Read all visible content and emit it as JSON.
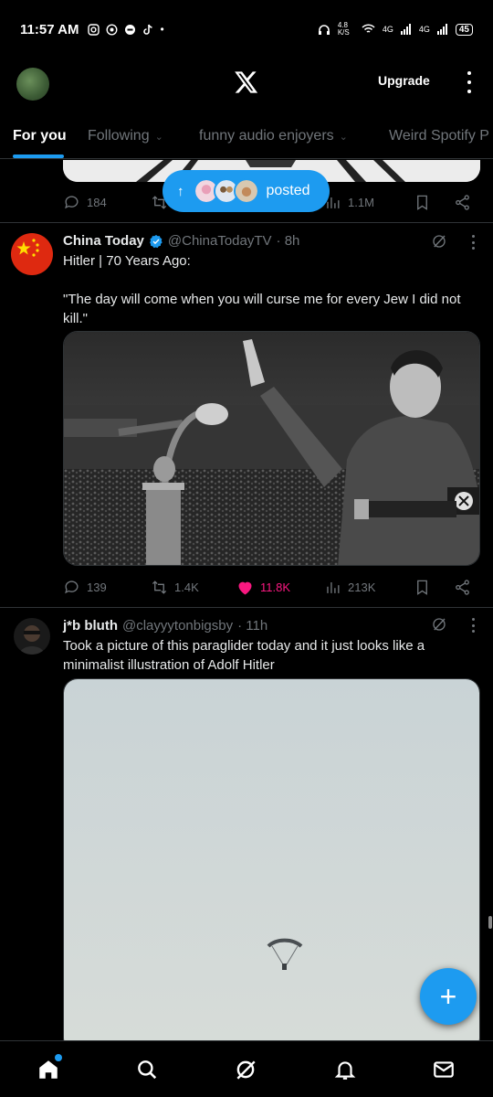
{
  "status_bar": {
    "time": "11:57 AM",
    "left_icons": [
      "instagram-icon",
      "whatsapp-icon",
      "messenger-icon",
      "tiktok-icon"
    ],
    "dot": "•",
    "net_speed": "4.8 K/S",
    "signal_1": "4G",
    "signal_2": "4G",
    "battery": "45"
  },
  "header": {
    "logo": "X",
    "upgrade_label": "Upgrade"
  },
  "tabs": [
    {
      "label": "For you",
      "active": true
    },
    {
      "label": "Following",
      "dropdown": true
    },
    {
      "label": "funny audio enjoyers",
      "dropdown": true
    },
    {
      "label": "Weird Spotify P",
      "dropdown": false
    }
  ],
  "posted_pill": {
    "label": "posted"
  },
  "post0": {
    "reply_count": "184",
    "views": "1.1M"
  },
  "tweet1": {
    "name": "China Today",
    "handle": "@ChinaTodayTV",
    "time": "· 8h",
    "verified": true,
    "text": "Hitler | 70 Years Ago:\n\n\"The day will come when you will curse me for every Jew I did not kill.\"",
    "replies": "139",
    "reposts": "1.4K",
    "likes": "11.8K",
    "views": "213K",
    "liked": true
  },
  "tweet2": {
    "name": "j*b bluth",
    "handle": "@clayyytonbigsby",
    "time": "· 11h",
    "text": "Took a picture of this paraglider today and it just looks like a minimalist illustration of Adolf Hitler"
  },
  "fab": {
    "label": "+"
  },
  "colors": {
    "accent": "#1d9bf0",
    "like": "#f91880",
    "muted": "#71767b",
    "divider": "#2f3336"
  }
}
